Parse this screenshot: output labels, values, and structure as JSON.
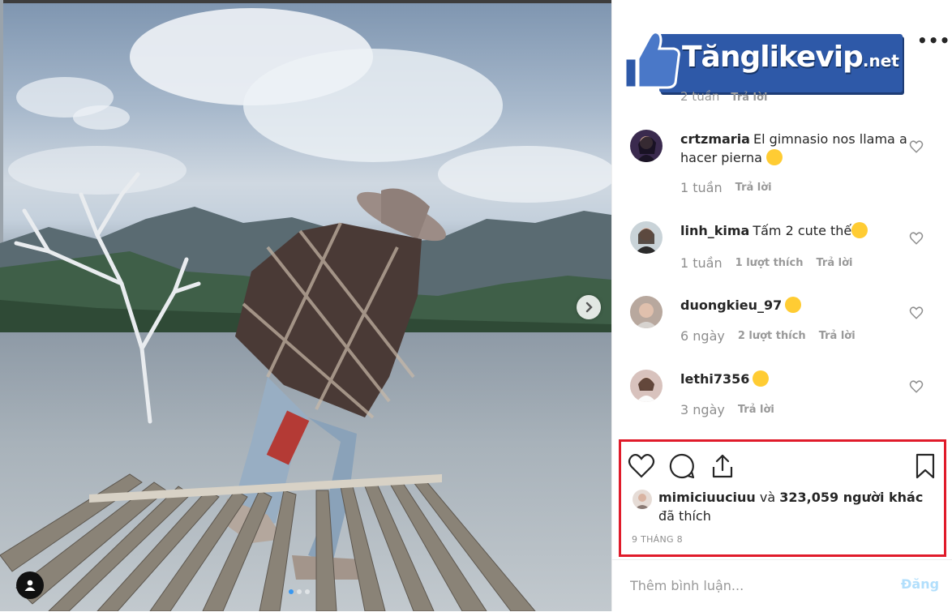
{
  "post": {
    "carousel_dots": 3,
    "active_dot": 0
  },
  "header": {
    "logo_text": "Tănglikevip",
    "logo_suffix": ".net",
    "more_label": "•••"
  },
  "partial_comment": {
    "time": "2 tuần",
    "reply_label": "Trả lời"
  },
  "comments": [
    {
      "username": "crtzmaria",
      "text": "El gimnasio nos llama a hacer pierna",
      "emoji": "hugging-face",
      "time": "1 tuần",
      "likes": "",
      "reply_label": "Trả lời"
    },
    {
      "username": "linh_kima",
      "text": "Tấm 2 cute thế",
      "emoji": "star-struck",
      "time": "1 tuần",
      "likes": "1 lượt thích",
      "reply_label": "Trả lời"
    },
    {
      "username": "duongkieu_97",
      "text": "",
      "emoji": "star-struck",
      "time": "6 ngày",
      "likes": "2 lượt thích",
      "reply_label": "Trả lời"
    },
    {
      "username": "lethi7356",
      "text": "",
      "emoji": "star-struck",
      "time": "3 ngày",
      "likes": "",
      "reply_label": "Trả lời"
    }
  ],
  "actions": {
    "like_icon": "heart-icon",
    "comment_icon": "comment-icon",
    "share_icon": "share-icon",
    "save_icon": "bookmark-icon"
  },
  "liked_by": {
    "user": "mimiciuuciuu",
    "connector": "và",
    "count": "323,059 người khác",
    "suffix": "đã thích"
  },
  "date": "9 THÁNG 8",
  "add_comment": {
    "placeholder": "Thêm bình luận...",
    "post_label": "Đăng"
  },
  "colors": {
    "highlight_border": "#e01b2a",
    "post_button": "#b2dffc",
    "logo_blue": "#2e59a8"
  }
}
